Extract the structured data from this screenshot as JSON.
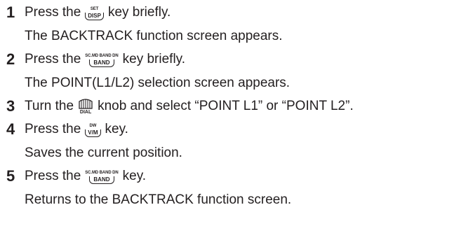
{
  "steps": [
    {
      "number": "1",
      "before": "Press the",
      "key": {
        "caption": "SET",
        "label": "DISP"
      },
      "after": "key briefly.",
      "result": "The BACKTRACK function screen appears."
    },
    {
      "number": "2",
      "before": "Press the",
      "key": {
        "caption": "SC.MD BAND DN",
        "label": "BAND"
      },
      "after": "key briefly.",
      "result": "The POINT(L1/L2) selection screen appears."
    },
    {
      "number": "3",
      "before": "Turn the",
      "key": {
        "caption": "",
        "label": "DIAL"
      },
      "after": "knob and select “POINT L1” or “POINT L2”.",
      "result": ""
    },
    {
      "number": "4",
      "before": "Press the",
      "key": {
        "caption": "DW",
        "label": "V/M"
      },
      "after": "key.",
      "result": "Saves the current position."
    },
    {
      "number": "5",
      "before": "Press the",
      "key": {
        "caption": "SC.MD BAND DN",
        "label": "BAND"
      },
      "after": "key.",
      "result": "Returns to the BACKTRACK function screen."
    }
  ]
}
